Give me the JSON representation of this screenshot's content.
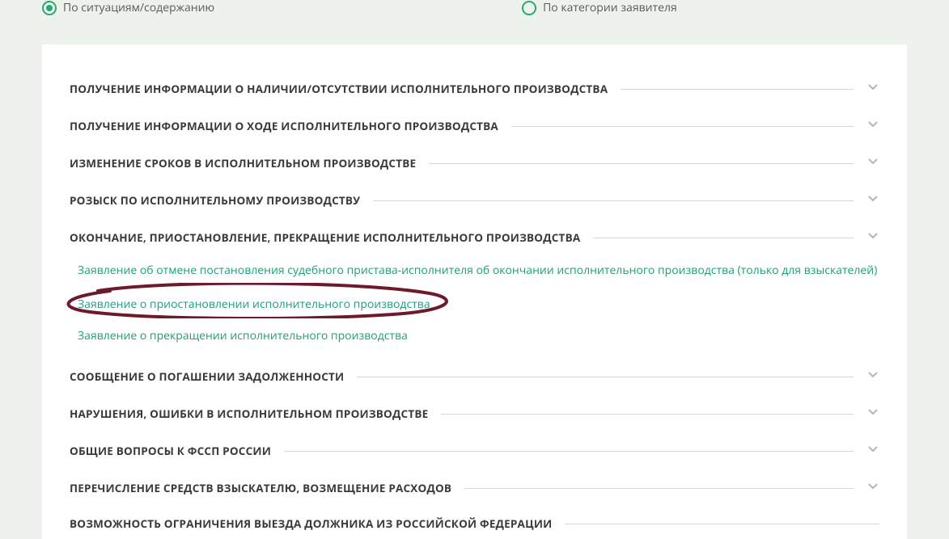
{
  "tabs": {
    "t1": "По ситуациям/содержанию",
    "t2": "По категории заявителя"
  },
  "rows": {
    "r1": "ПОЛУЧЕНИЕ ИНФОРМАЦИИ О НАЛИЧИИ/ОТСУТСТВИИ ИСПОЛНИТЕЛЬНОГО ПРОИЗВОДСТВА",
    "r2": "ПОЛУЧЕНИЕ ИНФОРМАЦИИ О ХОДЕ ИСПОЛНИТЕЛЬНОГО ПРОИЗВОДСТВА",
    "r3": "ИЗМЕНЕНИЕ СРОКОВ В ИСПОЛНИТЕЛЬНОМ ПРОИЗВОДСТВЕ",
    "r4": "РОЗЫСК ПО ИСПОЛНИТЕЛЬНОМУ ПРОИЗВОДСТВУ",
    "r5": "ОКОНЧАНИЕ, ПРИОСТАНОВЛЕНИЕ, ПРЕКРАЩЕНИЕ ИСПОЛНИТЕЛЬНОГО ПРОИЗВОДСТВА",
    "r6": "СООБЩЕНИЕ О ПОГАШЕНИИ ЗАДОЛЖЕННОСТИ",
    "r7": "НАРУШЕНИЯ, ОШИБКИ В ИСПОЛНИТЕЛЬНОМ ПРОИЗВОДСТВЕ",
    "r8": "ОБЩИЕ ВОПРОСЫ К ФССП РОССИИ",
    "r9": "ПЕРЕЧИСЛЕНИЕ СРЕДСТВ ВЗЫСКАТЕЛЮ, ВОЗМЕЩЕНИЕ РАСХОДОВ",
    "r10": "ВОЗМОЖНОСТЬ ОГРАНИЧЕНИЯ ВЫЕЗДА ДОЛЖНИКА ИЗ РОССИЙСКОЙ ФЕДЕРАЦИИ"
  },
  "links": {
    "l1": "Заявление об отмене постановления судебного пристава-исполнителя об окончании исполнительного производства (только для взыскателей)",
    "l2": "Заявление о приостановлении исполнительного производства",
    "l3": "Заявление о прекращении исполнительного производства"
  }
}
